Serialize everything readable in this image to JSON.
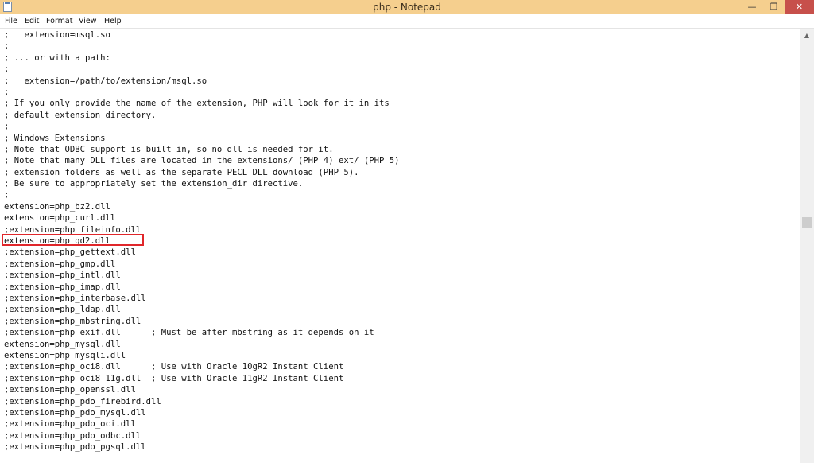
{
  "window": {
    "title": "php - Notepad"
  },
  "icons": {
    "app": "notepad-icon",
    "minimize": "minimize-icon",
    "maximize": "restore-icon",
    "close": "close-icon",
    "scroll_up": "arrow-up-icon"
  },
  "menu": {
    "file": "File",
    "edit": "Edit",
    "format": "Format",
    "view": "View",
    "help": "Help"
  },
  "highlight_color": "#e0262a",
  "lines": [
    ";   extension=msql.so",
    ";",
    "; ... or with a path:",
    ";",
    ";   extension=/path/to/extension/msql.so",
    ";",
    "; If you only provide the name of the extension, PHP will look for it in its",
    "; default extension directory.",
    ";",
    "; Windows Extensions",
    "; Note that ODBC support is built in, so no dll is needed for it.",
    "; Note that many DLL files are located in the extensions/ (PHP 4) ext/ (PHP 5)",
    "; extension folders as well as the separate PECL DLL download (PHP 5).",
    "; Be sure to appropriately set the extension_dir directive.",
    ";",
    "extension=php_bz2.dll",
    "extension=php_curl.dll",
    ";extension=php_fileinfo.dll",
    "extension=php_gd2.dll",
    ";extension=php_gettext.dll",
    ";extension=php_gmp.dll",
    ";extension=php_intl.dll",
    ";extension=php_imap.dll",
    ";extension=php_interbase.dll",
    ";extension=php_ldap.dll",
    ";extension=php_mbstring.dll",
    ";extension=php_exif.dll      ; Must be after mbstring as it depends on it",
    "extension=php_mysql.dll",
    "extension=php_mysqli.dll",
    ";extension=php_oci8.dll      ; Use with Oracle 10gR2 Instant Client",
    ";extension=php_oci8_11g.dll  ; Use with Oracle 11gR2 Instant Client",
    ";extension=php_openssl.dll",
    ";extension=php_pdo_firebird.dll",
    ";extension=php_pdo_mysql.dll",
    ";extension=php_pdo_oci.dll",
    ";extension=php_pdo_odbc.dll",
    ";extension=php_pdo_pgsql.dll"
  ]
}
